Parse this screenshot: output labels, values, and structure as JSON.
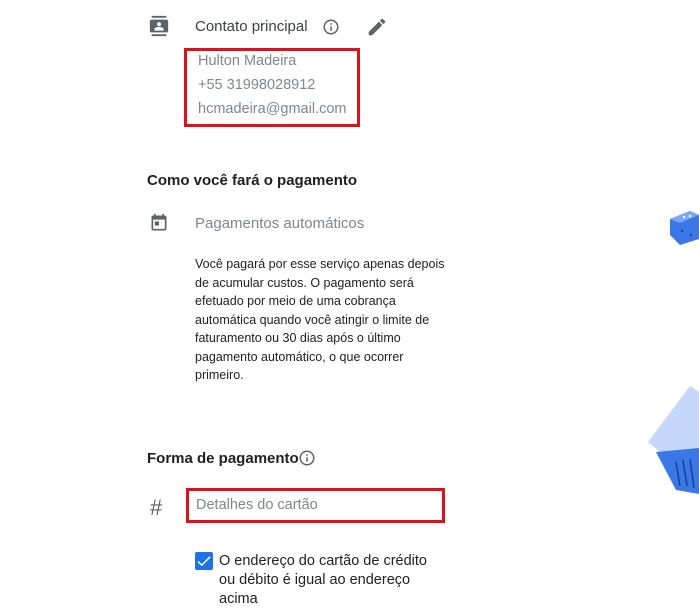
{
  "contact": {
    "title": "Contato principal",
    "name": "Hulton Madeira",
    "phone": "+55  31998028912",
    "email": "hcmadeira@gmail.com"
  },
  "payment_schedule": {
    "heading": "Como você fará o pagamento",
    "option_label": "Pagamentos automáticos",
    "description": "Você pagará por esse serviço apenas depois de acumular custos. O pagamento será efetuado por meio de uma cobrança automática quando você atingir o limite de faturamento ou 30 dias após o último pagamento automático, o que ocorrer primeiro."
  },
  "payment_method": {
    "heading": "Forma de pagamento",
    "card_placeholder": "Detalhes do cartão",
    "checkbox_checked": true,
    "checkbox_label": "O endereço do cartão de crédito ou débito é igual ao endereço acima"
  },
  "icons": {
    "contact": "contact-card-icon",
    "info": "info-icon",
    "edit": "pencil-icon",
    "calendar": "calendar-icon",
    "hash": "hash-icon",
    "check": "check-icon"
  },
  "colors": {
    "highlight_border": "#e0101a",
    "checkbox": "#1a73e8",
    "muted_text": "#80868b",
    "icon": "#5f6368",
    "illustration_blue": "#3b78e7"
  }
}
